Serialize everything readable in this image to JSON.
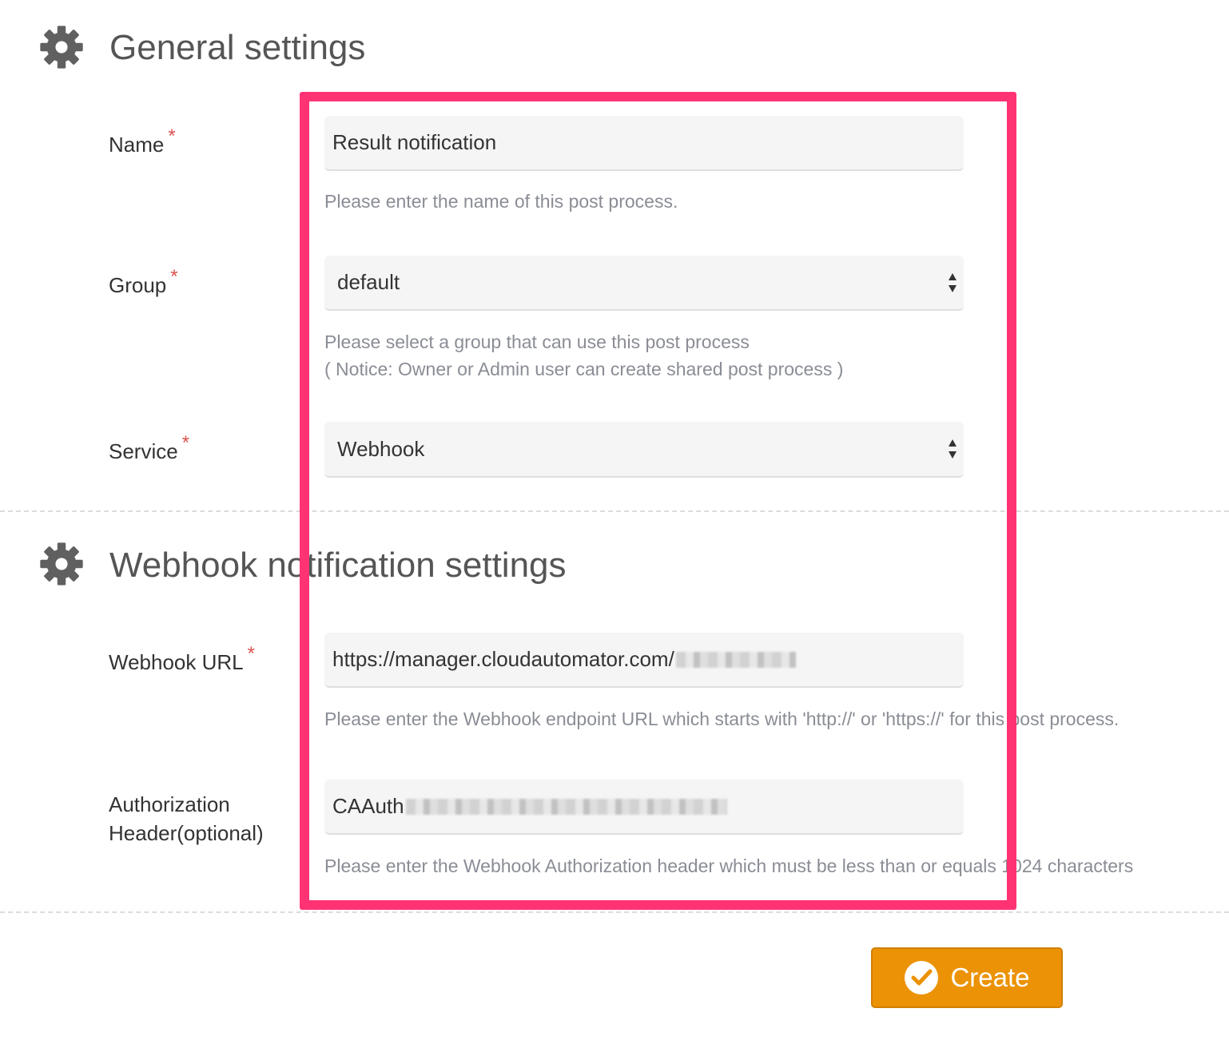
{
  "general": {
    "title": "General settings",
    "name": {
      "label": "Name",
      "required_mark": "*",
      "value": "Result notification",
      "help": "Please enter the name of this post process."
    },
    "group": {
      "label": "Group",
      "required_mark": "*",
      "value": "default",
      "help_line1": "Please select a group that can use this post process",
      "help_line2": "( Notice: Owner or Admin user can create shared post process )"
    },
    "service": {
      "label": "Service",
      "required_mark": "*",
      "value": "Webhook"
    }
  },
  "webhook": {
    "title": "Webhook notification settings",
    "url": {
      "label": "Webhook URL",
      "required_mark": "*",
      "value": "https://manager.cloudautomator.com/",
      "help": "Please enter the Webhook endpoint URL which starts with 'http://' or 'https://' for this post process."
    },
    "auth": {
      "label_line1": "Authorization",
      "label_line2": "Header(optional)",
      "value": "CAAuth",
      "help": "Please enter the Webhook Authorization header which must be less than or equals 1024 characters"
    }
  },
  "actions": {
    "create_label": "Create"
  },
  "icons": {
    "section": "gear-icon",
    "select": "updown-arrows-icon",
    "create": "check-circle-icon"
  },
  "colors": {
    "highlight": "#ff3374",
    "create_button": "#ec9205",
    "required": "#d9534f"
  }
}
